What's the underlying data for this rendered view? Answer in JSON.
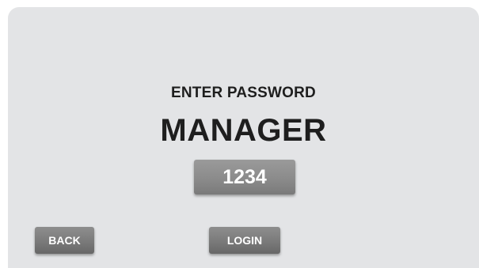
{
  "screen": {
    "prompt": "ENTER PASSWORD",
    "user_name": "MANAGER",
    "password_value": "1234"
  },
  "buttons": {
    "back_label": "BACK",
    "login_label": "LOGIN"
  },
  "colors": {
    "panel_background": "#e3e4e6",
    "button_gray": "#808080",
    "text_dark": "#1e1e1e"
  }
}
